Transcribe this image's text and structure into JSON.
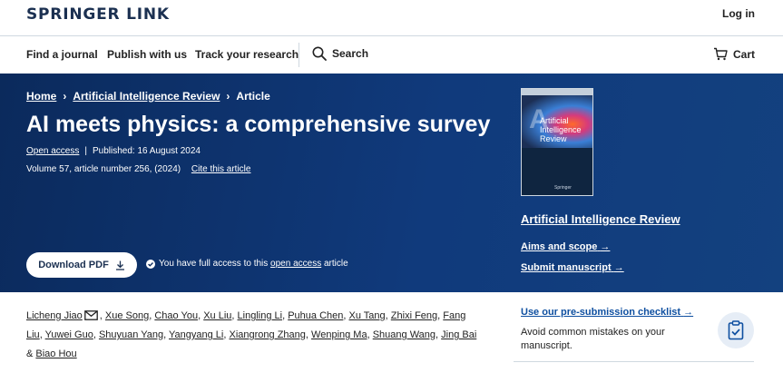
{
  "brand": {
    "name": "SPRINGER LINK"
  },
  "header": {
    "login_label": "Log in"
  },
  "nav": {
    "items": [
      "Find a journal",
      "Publish with us",
      "Track your research"
    ],
    "search_label": "Search",
    "cart_label": "Cart"
  },
  "breadcrumb": [
    "Home",
    "Artificial Intelligence Review",
    "Article"
  ],
  "article": {
    "title": "AI meets physics: a comprehensive survey",
    "open_access": "Open access",
    "published": "Published: 16 August 2024",
    "volume_line": "Volume 57, article number 256, (2024)",
    "cite_label": "Cite this article"
  },
  "download": {
    "label": "Download PDF"
  },
  "access_note": {
    "prefix": "You have full access to this",
    "link": "open access",
    "suffix": "article"
  },
  "journal": {
    "cover_title_line1": "Artificial",
    "cover_title_line2": "Intelligence",
    "cover_title_line3": "Review",
    "cover_publisher": "Springer",
    "name": "Artificial Intelligence Review",
    "aims_label": "Aims and scope",
    "submit_label": "Submit manuscript"
  },
  "authors": [
    "Licheng Jiao",
    "Xue Song",
    "Chao You",
    "Xu Liu",
    "Lingling Li",
    "Puhua Chen",
    "Xu Tang",
    "Zhixi Feng",
    "Fang Liu",
    "Yuwei Guo",
    "Shuyuan Yang",
    "Yangyang Li",
    "Xiangrong Zhang",
    "Wenping Ma",
    "Shuang Wang",
    "Jing Bai",
    "Biao Hou"
  ],
  "checklist": {
    "link": "Use our pre-submission checklist",
    "description": "Avoid common mistakes on your manuscript."
  },
  "colors": {
    "hero_bg": "#0b2a5c",
    "link_blue": "#0e4fa0",
    "brand_navy": "#1b3051"
  }
}
